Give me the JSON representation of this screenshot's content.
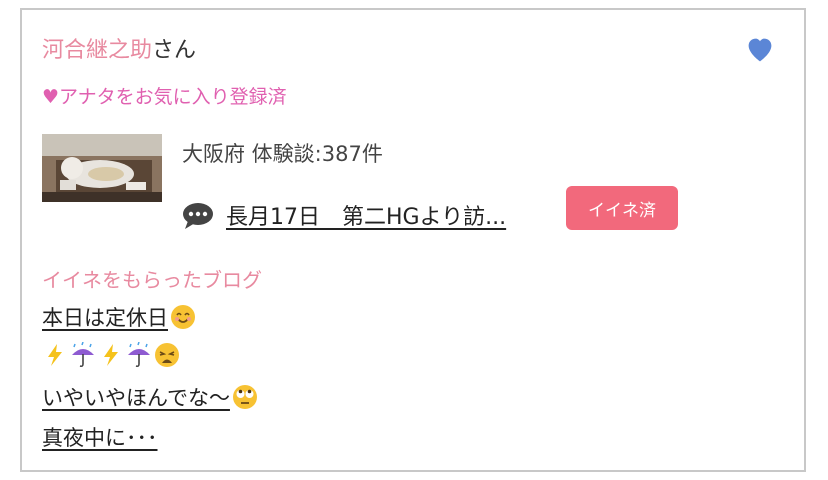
{
  "user": {
    "name": "河合継之助",
    "suffix": "さん"
  },
  "favorite_status": "♥アナタをお気に入り登録済",
  "icons": {
    "heart": "heart-icon",
    "comment": "comment-bubble-icon"
  },
  "profile": {
    "region_count": "大阪府  体験談:387件"
  },
  "diary": {
    "title": "長月17日　第二HGより訪..."
  },
  "like_button": {
    "label": "イイネ済"
  },
  "blogs": {
    "heading": "イイネをもらったブログ",
    "items": [
      {
        "text": "本日は定休日",
        "emojis": [
          "smiling-face"
        ]
      },
      {
        "text": "",
        "emojis": [
          "lightning",
          "umbrella-rain",
          "lightning",
          "umbrella-rain",
          "weary-face"
        ]
      },
      {
        "text": "いやいやほんでな〜",
        "emojis": [
          "eye-roll-face"
        ]
      },
      {
        "text": "真夜中に･･･",
        "emojis": []
      }
    ]
  },
  "colors": {
    "accent_pink": "#e88aa0",
    "button": "#f2697c",
    "heart": "#5b86d6",
    "fav_text": "#e060b0"
  }
}
